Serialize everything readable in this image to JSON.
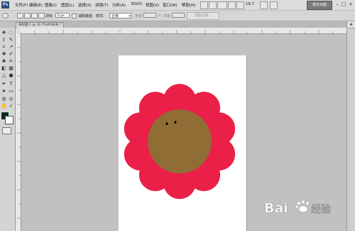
{
  "app": {
    "logo": "Ps"
  },
  "menubar": {
    "items": [
      "文件(F)",
      "编辑(E)",
      "图像(I)",
      "图层(L)",
      "选择(S)",
      "滤镜(T)",
      "分析(A)",
      "3D(D)",
      "视图(V)",
      "窗口(W)",
      "帮助(H)"
    ],
    "zoom": "16.7",
    "workspace_button": "基本功能"
  },
  "options": {
    "feather_label": "羽化:",
    "feather_value": "0 px",
    "antialias_label": "消除锯齿",
    "style_label": "样式:",
    "style_value": "正常",
    "width_label": "宽度:",
    "height_label": "高度:",
    "refine_edge_button": "调整边缘..."
  },
  "document": {
    "tab_title": "未标题-1 @ 16.7%(RGB/8) *"
  },
  "colors": {
    "petal": "#ea2049",
    "center": "#916d36",
    "canvas_bg": "#c1c1c1",
    "foreground": "#0c2a20",
    "background": "#ffffff"
  },
  "watermark": {
    "brand": "Bai",
    "brand_tail": "经验",
    "url": "jingyan.baidu.com"
  }
}
